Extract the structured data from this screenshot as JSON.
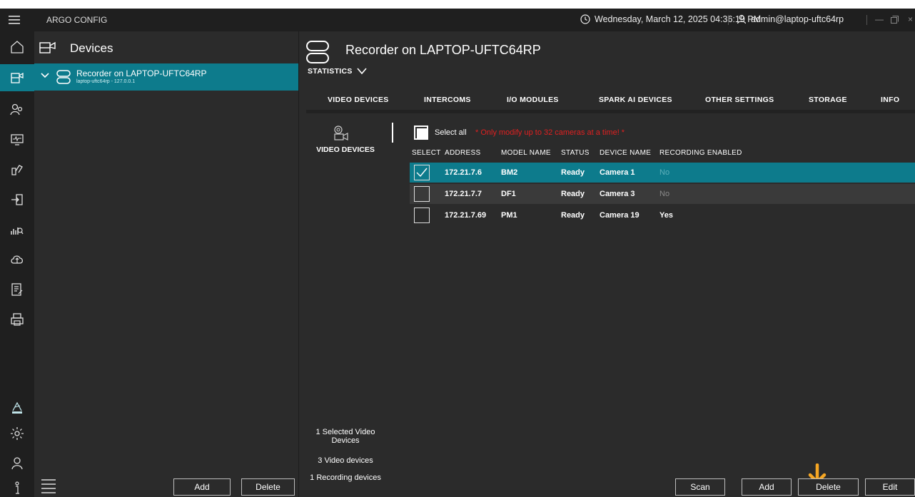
{
  "app": {
    "title": "ARGO CONFIG"
  },
  "header": {
    "datetime": "Wednesday, March 12, 2025 04:36:19 PM",
    "user": "admin@laptop-uftc64rp"
  },
  "devices_panel": {
    "title": "Devices",
    "tree_item": {
      "name": "Recorder on LAPTOP-UFTC64RP",
      "sub": "laptop-uftc64rp - 127.0.0.1"
    },
    "add_label": "Add",
    "delete_label": "Delete"
  },
  "main": {
    "title": "Recorder on LAPTOP-UFTC64RP",
    "statistics_label": "STATISTICS",
    "tabs": [
      "VIDEO DEVICES",
      "INTERCOMS",
      "I/O MODULES",
      "SPARK AI DEVICES",
      "OTHER SETTINGS",
      "STORAGE",
      "INFO"
    ],
    "section_label": "VIDEO DEVICES",
    "select_all": "Select all",
    "warning": "* Only modify up to 32 cameras at a time! *",
    "columns": [
      "SELECT",
      "ADDRESS",
      "MODEL NAME",
      "STATUS",
      "DEVICE NAME",
      "RECORDING ENABLED"
    ],
    "rows": [
      {
        "selected": true,
        "address": "172.21.7.6",
        "model": "BM2",
        "status": "Ready",
        "device": "Camera 1",
        "recording": "No"
      },
      {
        "selected": false,
        "address": "172.21.7.7",
        "model": "DF1",
        "status": "Ready",
        "device": "Camera 3",
        "recording": "No"
      },
      {
        "selected": false,
        "address": "172.21.7.69",
        "model": "PM1",
        "status": "Ready",
        "device": "Camera 19",
        "recording": "Yes"
      }
    ],
    "summary": {
      "selected": "1 Selected Video Devices",
      "total": "3 Video devices",
      "recording": "1 Recording devices"
    },
    "buttons": {
      "scan": "Scan",
      "add": "Add",
      "delete": "Delete",
      "edit": "Edit"
    }
  },
  "colors": {
    "accent": "#0d7b8c",
    "tab_accent": "#0d8fa3",
    "warning": "#e02020",
    "arrow": "#f5a623",
    "row_hover": "#3a3a3a"
  }
}
